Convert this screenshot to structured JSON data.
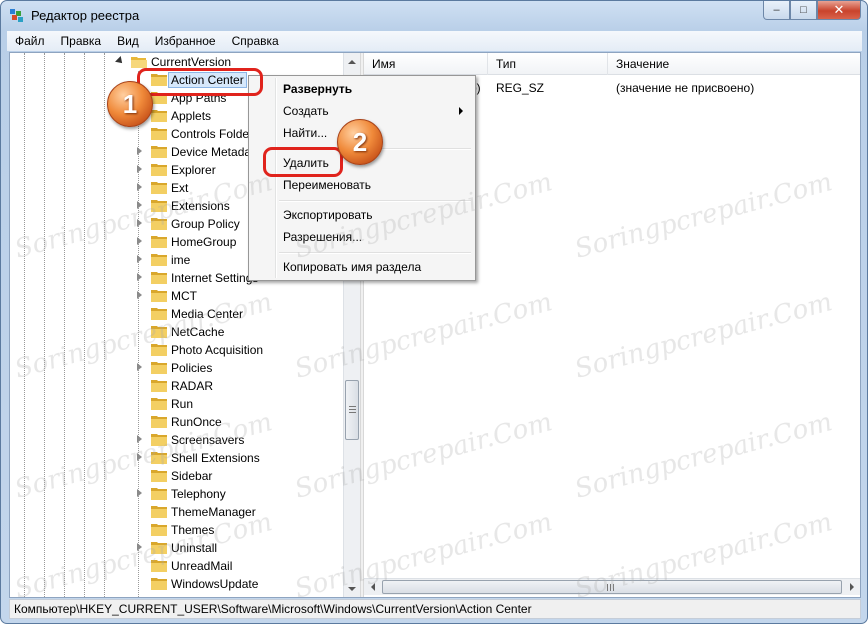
{
  "window": {
    "title": "Редактор реестра"
  },
  "caption_buttons": {
    "minimize": "–",
    "maximize": "□",
    "close": "✕"
  },
  "menu": [
    "Файл",
    "Правка",
    "Вид",
    "Избранное",
    "Справка"
  ],
  "tree": {
    "parent": "CurrentVersion",
    "items": [
      "Action Center",
      "App Paths",
      "Applets",
      "Controls Folde",
      "Device Metada",
      "Explorer",
      "Ext",
      "Extensions",
      "Group Policy",
      "HomeGroup",
      "ime",
      "Internet Settings",
      "MCT",
      "Media Center",
      "NetCache",
      "Photo Acquisition",
      "Policies",
      "RADAR",
      "Run",
      "RunOnce",
      "Screensavers",
      "Shell Extensions",
      "Sidebar",
      "Telephony",
      "ThemeManager",
      "Themes",
      "Uninstall",
      "UnreadMail",
      "WindowsUpdate"
    ],
    "selected": "Action Center"
  },
  "list": {
    "columns": [
      "Имя",
      "Тип",
      "Значение"
    ],
    "rows": [
      {
        "name": "b)",
        "type": "REG_SZ",
        "value": "(значение не присвоено)"
      }
    ]
  },
  "context_menu": {
    "items": [
      "Развернуть",
      "Создать",
      "Найти...",
      "Удалить",
      "Переименовать",
      "Экспортировать",
      "Разрешения...",
      "Копировать имя раздела"
    ]
  },
  "annotations": {
    "badge1": "1",
    "badge2": "2",
    "accent": "#e0231c"
  },
  "status": {
    "path": "Компьютер\\HKEY_CURRENT_USER\\Software\\Microsoft\\Windows\\CurrentVersion\\Action Center"
  },
  "watermark": "Soringpcrepair.Com"
}
